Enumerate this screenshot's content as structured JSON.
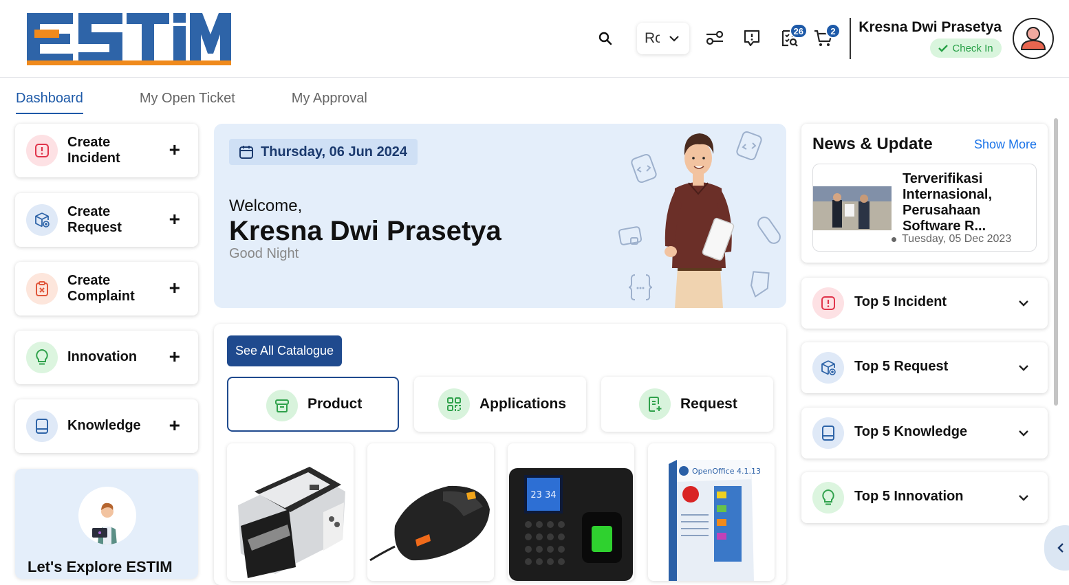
{
  "header": {
    "logo_text": "ESTiM",
    "language": "Ro",
    "notifications_badge": "26",
    "cart_badge": "2",
    "user_name": "Kresna Dwi Prasetya",
    "checkin_label": "Check In"
  },
  "tabs": [
    {
      "label": "Dashboard",
      "active": true
    },
    {
      "label": "My Open Ticket",
      "active": false
    },
    {
      "label": "My Approval",
      "active": false
    }
  ],
  "quick_actions": [
    {
      "label": "Create\nIncident",
      "icon": "alert-square-icon",
      "color": "#fde1e4"
    },
    {
      "label": "Create\nRequest",
      "icon": "box-plus-icon",
      "color": "#dfe9f7"
    },
    {
      "label": "Create\nComplaint",
      "icon": "clipboard-x-icon",
      "color": "#fde6dc"
    },
    {
      "label": "Innovation",
      "icon": "lightbulb-icon",
      "color": "#dcf5df"
    },
    {
      "label": "Knowledge",
      "icon": "book-icon",
      "color": "#dfe9f7"
    }
  ],
  "explore": {
    "title": "Let's Explore ESTIM"
  },
  "banner": {
    "date": "Thursday, 06 Jun 2024",
    "welcome": "Welcome,",
    "name": "Kresna Dwi Prasetya",
    "greeting": "Good Night"
  },
  "catalogue": {
    "see_all": "See All Catalogue",
    "tabs": [
      {
        "label": "Product",
        "active": true
      },
      {
        "label": "Applications",
        "active": false
      },
      {
        "label": "Request",
        "active": false
      }
    ],
    "products": [
      {
        "name": "money-counter-machine"
      },
      {
        "name": "gaming-mouse"
      },
      {
        "name": "fingerprint-attendance-machine",
        "screen_text": "23 34"
      },
      {
        "name": "openoffice-software-box",
        "box_text": "OpenOffice 4.1.13"
      }
    ]
  },
  "news": {
    "title": "News & Update",
    "show_more": "Show More",
    "headline": "Terverifikasi Internasional, Perusahaan Software R...",
    "date": "Tuesday, 05 Dec 2023"
  },
  "top5": [
    {
      "label": "Top 5 Incident",
      "icon": "alert-square-icon",
      "color": "#fde1e4"
    },
    {
      "label": "Top 5 Request",
      "icon": "box-plus-icon",
      "color": "#dfe9f7"
    },
    {
      "label": "Top 5 Knowledge",
      "icon": "book-icon",
      "color": "#dfe9f7"
    },
    {
      "label": "Top 5 Innovation",
      "icon": "lightbulb-icon",
      "color": "#dcf5df"
    }
  ],
  "colors": {
    "primary": "#1f4a8e",
    "logo_blue": "#2e64a8",
    "logo_orange": "#f08a1c",
    "success": "#27a046"
  }
}
